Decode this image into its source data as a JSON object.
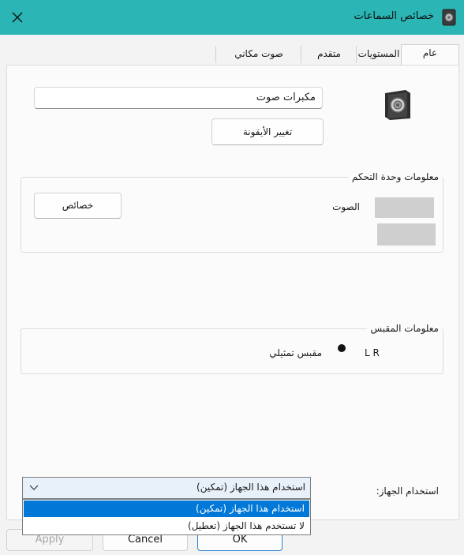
{
  "window": {
    "title": "خصائص السماعات",
    "close_icon": "close-icon"
  },
  "tabs": [
    {
      "label": "عام",
      "active": true
    },
    {
      "label": "المستويات"
    },
    {
      "label": "متقدم"
    },
    {
      "label": "صوت مكاني"
    }
  ],
  "general": {
    "device_name_value": "مكبرات صوت",
    "device_icon": "speaker-icon",
    "change_icon_button": "تغيير الأيقونة",
    "controller_info": {
      "label": "معلومات وحدة التحكم",
      "properties_button": "خصائص",
      "sound_label": "الصوت"
    },
    "jack_info": {
      "label": "معلومات المقبس",
      "jack_type": "مقبس تمثيلي",
      "channel_letters": "L R"
    },
    "device_usage": {
      "label": "استخدام الجهاز:",
      "selected": "استخدام هذا الجهاز (تمكين)",
      "options": [
        "استخدام هذا الجهاز (تمكين)",
        "لا تستخدم هذا الجهاز (تعطيل)"
      ]
    }
  },
  "footer": {
    "ok_button": "OK",
    "cancel_button": "Cancel",
    "apply_button": "Apply"
  },
  "colors": {
    "titlebar": "#2bb5b5",
    "selected_option": "#0078d7"
  }
}
